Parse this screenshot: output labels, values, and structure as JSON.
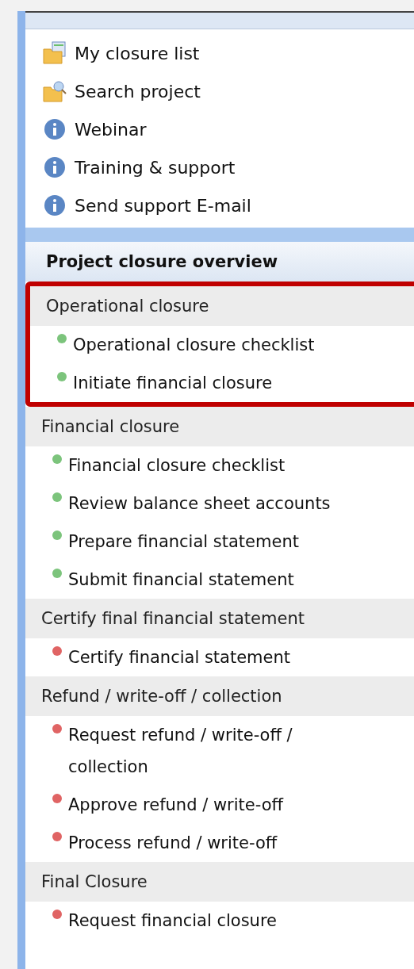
{
  "links": [
    {
      "label": "My closure list",
      "kind": "list"
    },
    {
      "label": "Search project",
      "kind": "search"
    },
    {
      "label": "Webinar",
      "kind": "info"
    },
    {
      "label": "Training & support",
      "kind": "info"
    },
    {
      "label": "Send support E-mail",
      "kind": "info"
    }
  ],
  "overview": {
    "title": "Project closure overview",
    "sections": [
      {
        "title": "Operational closure",
        "highlighted": true,
        "items": [
          {
            "label": "Operational closure checklist",
            "color": "#7cc47c"
          },
          {
            "label": "Initiate financial closure",
            "color": "#7cc47c"
          }
        ]
      },
      {
        "title": "Financial closure",
        "highlighted": false,
        "items": [
          {
            "label": "Financial closure checklist",
            "color": "#7cc47c"
          },
          {
            "label": "Review balance sheet accounts",
            "color": "#7cc47c"
          },
          {
            "label": "Prepare financial statement",
            "color": "#7cc47c"
          },
          {
            "label": "Submit financial statement",
            "color": "#7cc47c"
          }
        ]
      },
      {
        "title": "Certify final financial statement",
        "highlighted": false,
        "items": [
          {
            "label": "Certify financial statement",
            "color": "#e06464"
          }
        ]
      },
      {
        "title": "Refund / write-off / collection",
        "highlighted": false,
        "items": [
          {
            "label": "Request refund / write-off / collection",
            "color": "#e06464"
          },
          {
            "label": "Approve refund / write-off",
            "color": "#e06464"
          },
          {
            "label": "Process refund / write-off",
            "color": "#e06464"
          }
        ]
      },
      {
        "title": "Final Closure",
        "highlighted": false,
        "items": [
          {
            "label": "Request financial closure",
            "color": "#e06464"
          }
        ]
      }
    ]
  }
}
